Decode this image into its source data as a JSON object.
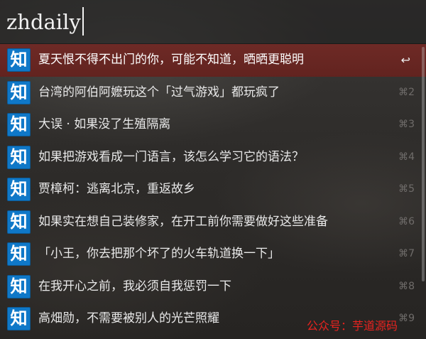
{
  "query": {
    "text": "zhdaily"
  },
  "results": [
    {
      "icon_label": "知",
      "icon": "zhihu-icon",
      "title": "夏天恨不得不出门的你，可能不知道，晒晒更聪明",
      "shortcut": "↩",
      "selected": true
    },
    {
      "icon_label": "知",
      "icon": "zhihu-icon",
      "title": "台湾的阿伯阿嬷玩这个「过气游戏」都玩疯了",
      "shortcut": "⌘2"
    },
    {
      "icon_label": "知",
      "icon": "zhihu-icon",
      "title": "大误 · 如果没了生殖隔离",
      "shortcut": "⌘3"
    },
    {
      "icon_label": "知",
      "icon": "zhihu-icon",
      "title": "如果把游戏看成一门语言，该怎么学习它的语法？",
      "shortcut": "⌘4"
    },
    {
      "icon_label": "知",
      "icon": "zhihu-icon",
      "title": "贾樟柯：逃离北京，重返故乡",
      "shortcut": "⌘5"
    },
    {
      "icon_label": "知",
      "icon": "zhihu-icon",
      "title": "如果实在想自己装修家，在开工前你需要做好这些准备",
      "shortcut": "⌘6"
    },
    {
      "icon_label": "知",
      "icon": "zhihu-icon",
      "title": "「小王，你去把那个坏了的火车轨道换一下」",
      "shortcut": "⌘7"
    },
    {
      "icon_label": "知",
      "icon": "zhihu-icon",
      "title": "在我开心之前，我必须自我惩罚一下",
      "shortcut": "⌘8"
    },
    {
      "icon_label": "知",
      "icon": "zhihu-icon",
      "title": "高畑勋，不需要被别人的光芒照耀",
      "shortcut": "⌘9"
    }
  ],
  "watermark": {
    "text": "公众号：芋道源码"
  },
  "colors": {
    "selected_row": "#6e2a26",
    "icon_bg": "#0f78c8",
    "watermark": "#e8231f"
  }
}
